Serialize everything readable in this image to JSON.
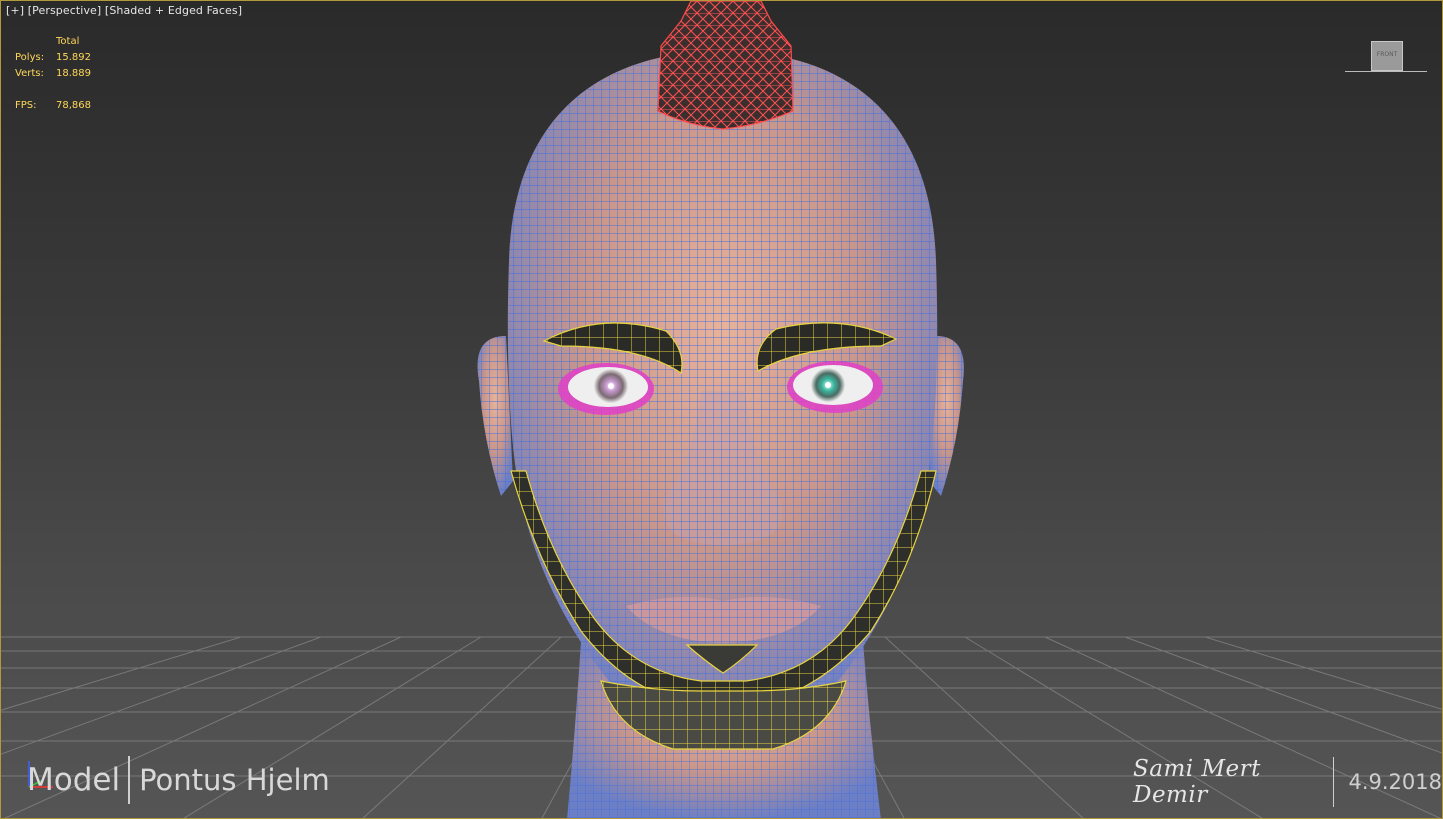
{
  "viewport": {
    "label": {
      "plus": "[+]",
      "view": "[Perspective]",
      "shading": "[Shaded + Edged Faces]"
    },
    "stats": {
      "header": "Total",
      "polys_label": "Polys:",
      "polys_value": "15.892",
      "verts_label": "Verts:",
      "verts_value": "18.889",
      "fps_label": "FPS:",
      "fps_value": "78,868"
    },
    "viewcube": {
      "face": "FRONT"
    },
    "border_color": "#b29a3c"
  },
  "credits": {
    "role": "Model",
    "modeler": "Pontus Hjelm",
    "signature": "Sami Mert Demir",
    "date": "4.9.2018"
  },
  "scene": {
    "object": "head-mesh",
    "wire_color": "#3c6cd8",
    "skin_color": "#d6a48e",
    "hair_wire_color": "#ff4a4a",
    "beard_wire_color": "#e8d440",
    "eyelash_wire_color": "#e040c8"
  }
}
